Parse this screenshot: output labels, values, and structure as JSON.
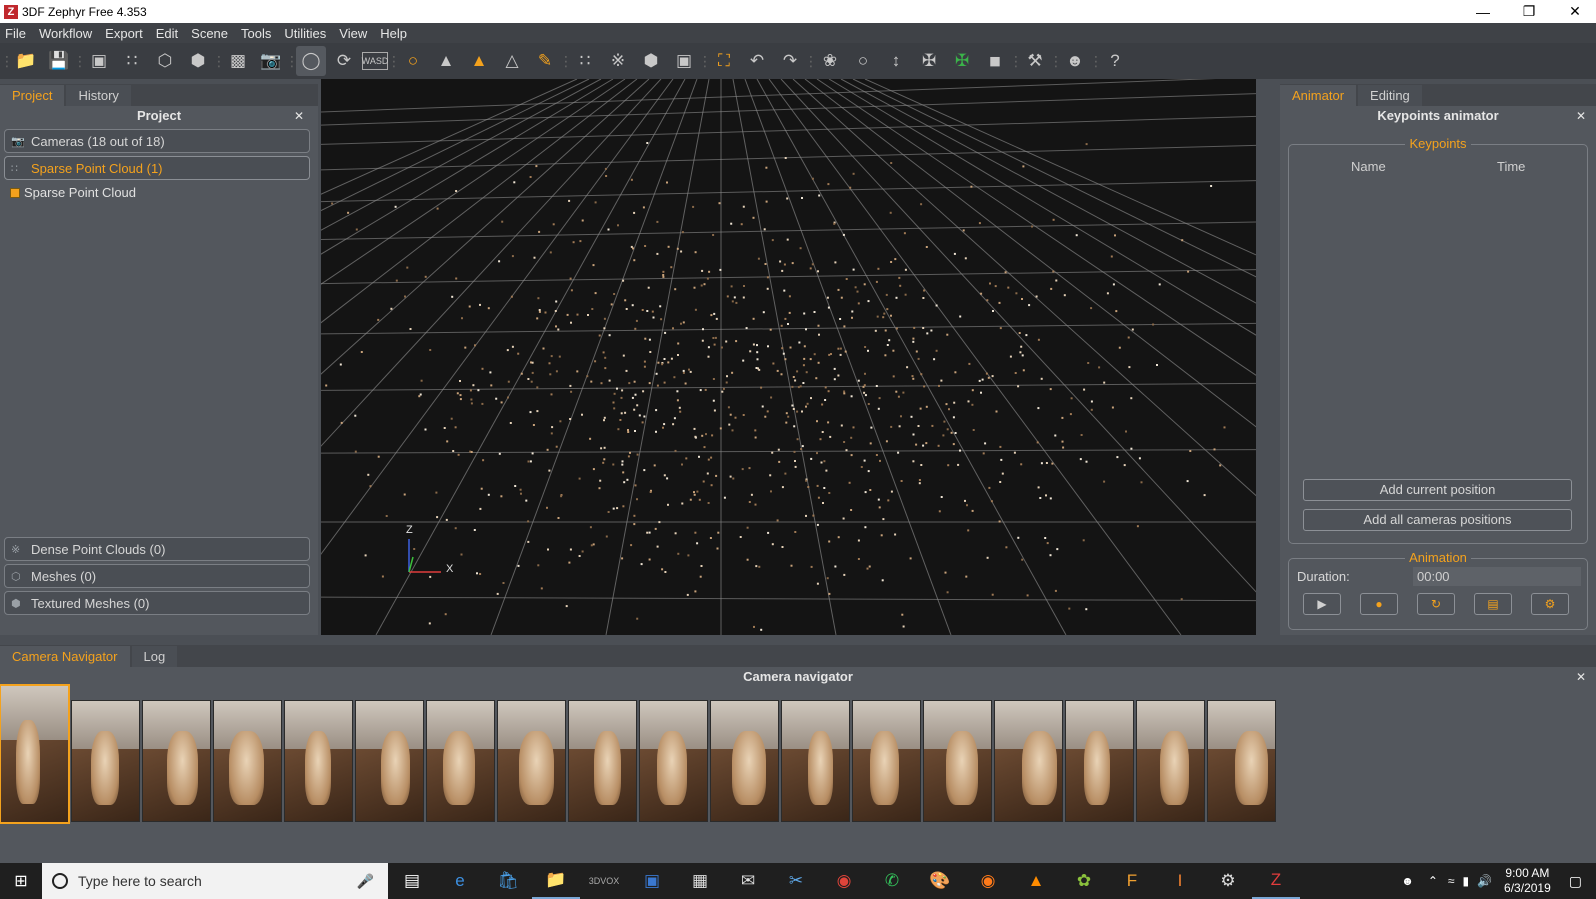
{
  "window": {
    "title": "3DF Zephyr Free 4.353",
    "app_icon": "Z"
  },
  "menu": [
    "File",
    "Workflow",
    "Export",
    "Edit",
    "Scene",
    "Tools",
    "Utilities",
    "View",
    "Help"
  ],
  "colors": {
    "accent": "#f4a21d",
    "panel": "#53575d",
    "viewport": "#141414"
  },
  "left_panel": {
    "tabs": [
      "Project",
      "History"
    ],
    "title": "Project",
    "groups_top": [
      {
        "label": "Cameras (18 out of 18)",
        "icon": "camera-icon",
        "selected": false
      },
      {
        "label": "Sparse Point Cloud (1)",
        "icon": "sparse-cloud-icon",
        "selected": true
      }
    ],
    "items": [
      {
        "label": "Sparse Point Cloud"
      }
    ],
    "groups_bottom": [
      {
        "label": "Dense Point Clouds (0)",
        "icon": "dense-cloud-icon"
      },
      {
        "label": "Meshes (0)",
        "icon": "mesh-icon"
      },
      {
        "label": "Textured Meshes (0)",
        "icon": "textured-mesh-icon"
      }
    ]
  },
  "viewport": {
    "axis_z": "Z",
    "axis_x": "X"
  },
  "right_panel": {
    "tabs": [
      "Animator",
      "Editing"
    ],
    "title": "Keypoints animator",
    "keypoints": {
      "legend": "Keypoints",
      "col_name": "Name",
      "col_time": "Time"
    },
    "buttons": {
      "add_current": "Add current position",
      "add_all": "Add all cameras positions"
    },
    "animation": {
      "legend": "Animation",
      "duration_label": "Duration:",
      "duration_value": "00:00"
    }
  },
  "bottom_panel": {
    "tabs": [
      "Camera Navigator",
      "Log"
    ],
    "title": "Camera navigator",
    "thumbnail_count": 18,
    "active_thumbnail": 0
  },
  "taskbar": {
    "search_placeholder": "Type here to search",
    "time": "9:00 AM",
    "date": "6/3/2019"
  }
}
